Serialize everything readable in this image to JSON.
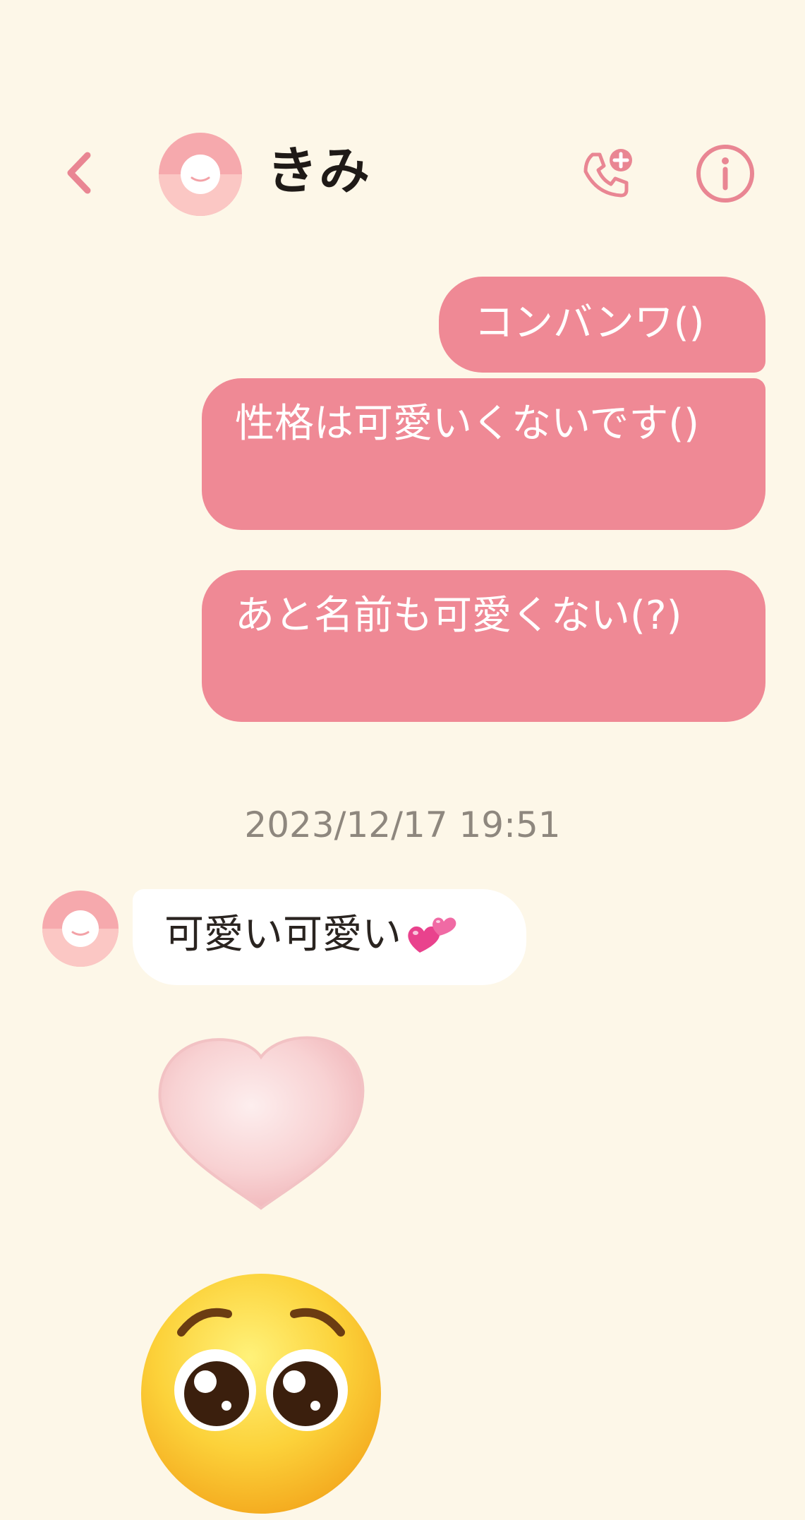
{
  "header": {
    "contact_name": "きみ",
    "back_icon": "chevron-left-icon",
    "call_icon": "phone-plus-icon",
    "info_icon": "info-circle-icon"
  },
  "messages_out": [
    {
      "text": "コンバンワ()"
    },
    {
      "text": "性格は可愛いくないです()"
    },
    {
      "text": "あと名前も可愛くない(?)"
    }
  ],
  "timestamp": "2023/12/17 19:51",
  "message_in": {
    "text": "可愛い可愛い",
    "emoji": "two-hearts-emoji"
  },
  "stickers": [
    "pink-heart-sticker",
    "pleading-face-emoji"
  ],
  "colors": {
    "background": "#fdf7e8",
    "accent": "#ef8995",
    "avatar_pink": "#f6a9ad"
  }
}
